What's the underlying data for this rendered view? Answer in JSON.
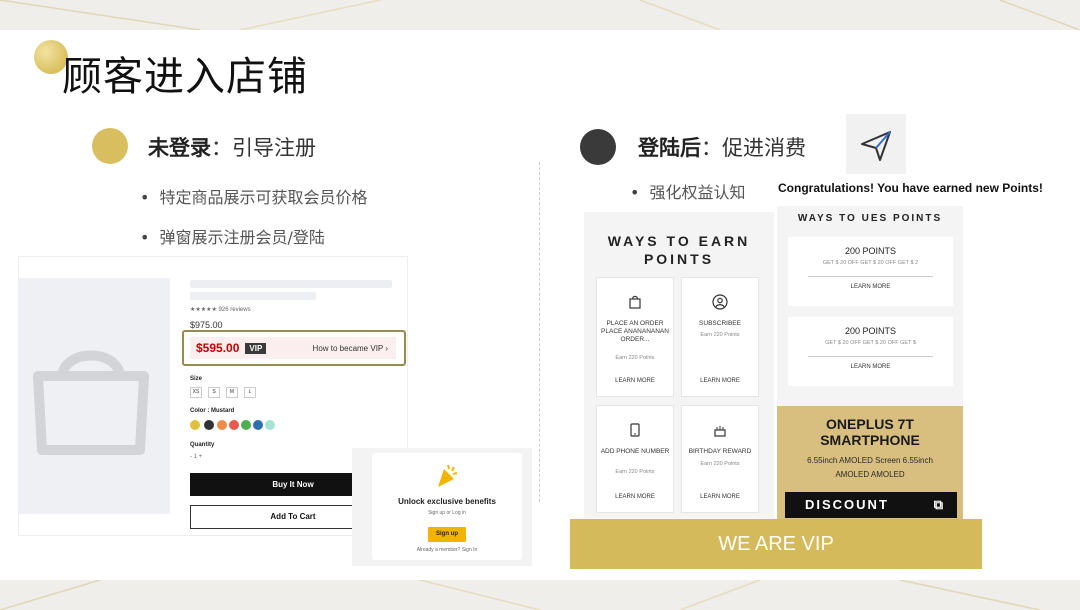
{
  "title": "顾客进入店铺",
  "left": {
    "head_bold": "未登录",
    "head_rest": "：引导注册",
    "bullets": [
      "特定商品展示可获取会员价格",
      "弹窗展示注册会员/登陆"
    ],
    "product": {
      "reviews": "★★★★★  926 reviews",
      "price": "$975.00",
      "vip_price": "$595.00",
      "vip_tag": "VIP",
      "vip_link": "How to became VIP  ›",
      "size_label": "Size",
      "sizes": [
        "XS",
        "S",
        "M",
        "L"
      ],
      "color_label": "Color : Mustard",
      "quantity_label": "Quantity",
      "quantity": "-   1   +",
      "buy_now": "Buy It Now",
      "add_to_cart": "Add To Cart",
      "swatch_colors": [
        "#e2c13a",
        "#333333",
        "#f28b4a",
        "#e85a4f",
        "#4caf50",
        "#2f6fb0",
        "#a7e3d5"
      ]
    },
    "popup": {
      "title": "Unlock exclusive benefits",
      "sub": "Sign up or Log in",
      "button": "Sign up",
      "footer": "Already a member?  Sign In"
    }
  },
  "right": {
    "head_bold": "登陆后",
    "head_rest": "：促进消费",
    "bullet": "强化权益认知",
    "congrats": "Congratulations! You have earned new Points!",
    "earn_title": "WAYS TO EARN POINTS",
    "earn_cards": [
      {
        "name": "PLACE AN ORDER PLACE ANANANANAN ORDER...",
        "points": "Earn 220 Points",
        "more": "LEARN MORE"
      },
      {
        "name": "SUBSCRIBEE",
        "points": "Earn 220 Points",
        "more": "LEARN MORE"
      },
      {
        "name": "ADD PHONE NUMBER",
        "points": "Earn 220 Points",
        "more": "LEARN MORE"
      },
      {
        "name": "BIRTHDAY REWARD",
        "points": "Earn 220 Points",
        "more": "LEARN MORE"
      }
    ],
    "ues_title": "WAYS TO UES POINTS",
    "ues_cards": [
      {
        "points": "200 POINTS",
        "desc": "GET $ 20 OFF GET $ 20 OFF GET $ 2",
        "more": "LEARN MORE"
      },
      {
        "points": "200 POINTS",
        "desc": "GET $ 20 OFF GET $ 20 OFF GET $",
        "more": "LEARN MORE"
      }
    ],
    "oneplus": {
      "title": "ONEPLUS 7T SMARTPHONE",
      "line1": "6.55inch AMOLED Screen 6.55inch",
      "line2": "AMOLED  AMOLED",
      "discount": "DISCOUNT"
    },
    "banner": "WE ARE VIP"
  },
  "colors": {
    "gold": "#d5ba5c",
    "dark_circle": "#3a3a3a",
    "vip_red": "#c40000"
  }
}
